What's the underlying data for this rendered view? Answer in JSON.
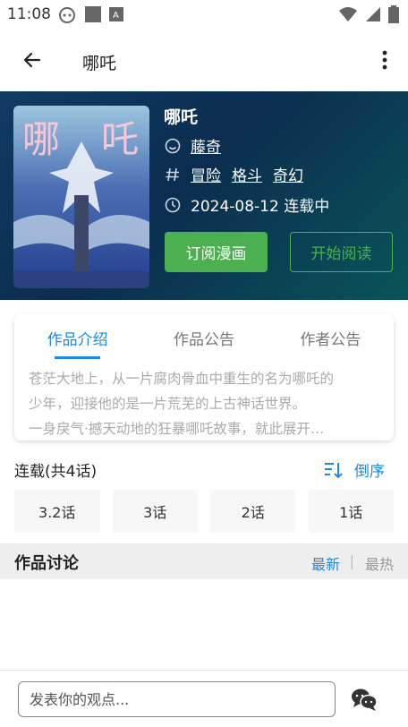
{
  "status_bar": {
    "time": "11:08",
    "icons_left": [
      "android-face-icon",
      "square-icon",
      "a-box-icon"
    ],
    "icons_right": [
      "wifi-icon",
      "signal-icon",
      "battery-icon"
    ]
  },
  "app_bar": {
    "title": "哪吒",
    "back_icon": "arrow-left-icon",
    "more_icon": "more-vert-icon"
  },
  "comic": {
    "cover_text_left": "哪",
    "cover_text_right": "吒",
    "title": "哪吒",
    "author": "藤奇",
    "tags": [
      "冒险",
      "格斗",
      "奇幻"
    ],
    "date_status": "2024-08-12 连载中",
    "subscribe_label": "订阅漫画",
    "read_label": "开始阅读"
  },
  "intro": {
    "tabs": [
      {
        "label": "作品介绍",
        "active": true
      },
      {
        "label": "作品公告",
        "active": false
      },
      {
        "label": "作者公告",
        "active": false
      }
    ],
    "lines": [
      "苍茫大地上，从一片腐肉骨血中重生的名为哪吒的",
      "少年，迎接他的是一片荒芜的上古神话世界。",
      "一身戾气·撼天动地的狂暴哪吒故事，就此展开…"
    ]
  },
  "chapters": {
    "title": "连载(共4话)",
    "sort_label": "倒序",
    "items": [
      "3.2话",
      "3话",
      "2话",
      "1话"
    ]
  },
  "discussion": {
    "title": "作品讨论",
    "latest_label": "最新",
    "separator": "|",
    "hot_label": "最热"
  },
  "comment_bar": {
    "placeholder": "发表你的观点..."
  },
  "colors": {
    "accent_blue": "#1e88e5",
    "green": "#4caf50",
    "hero_bg": "#0b2d4f"
  }
}
